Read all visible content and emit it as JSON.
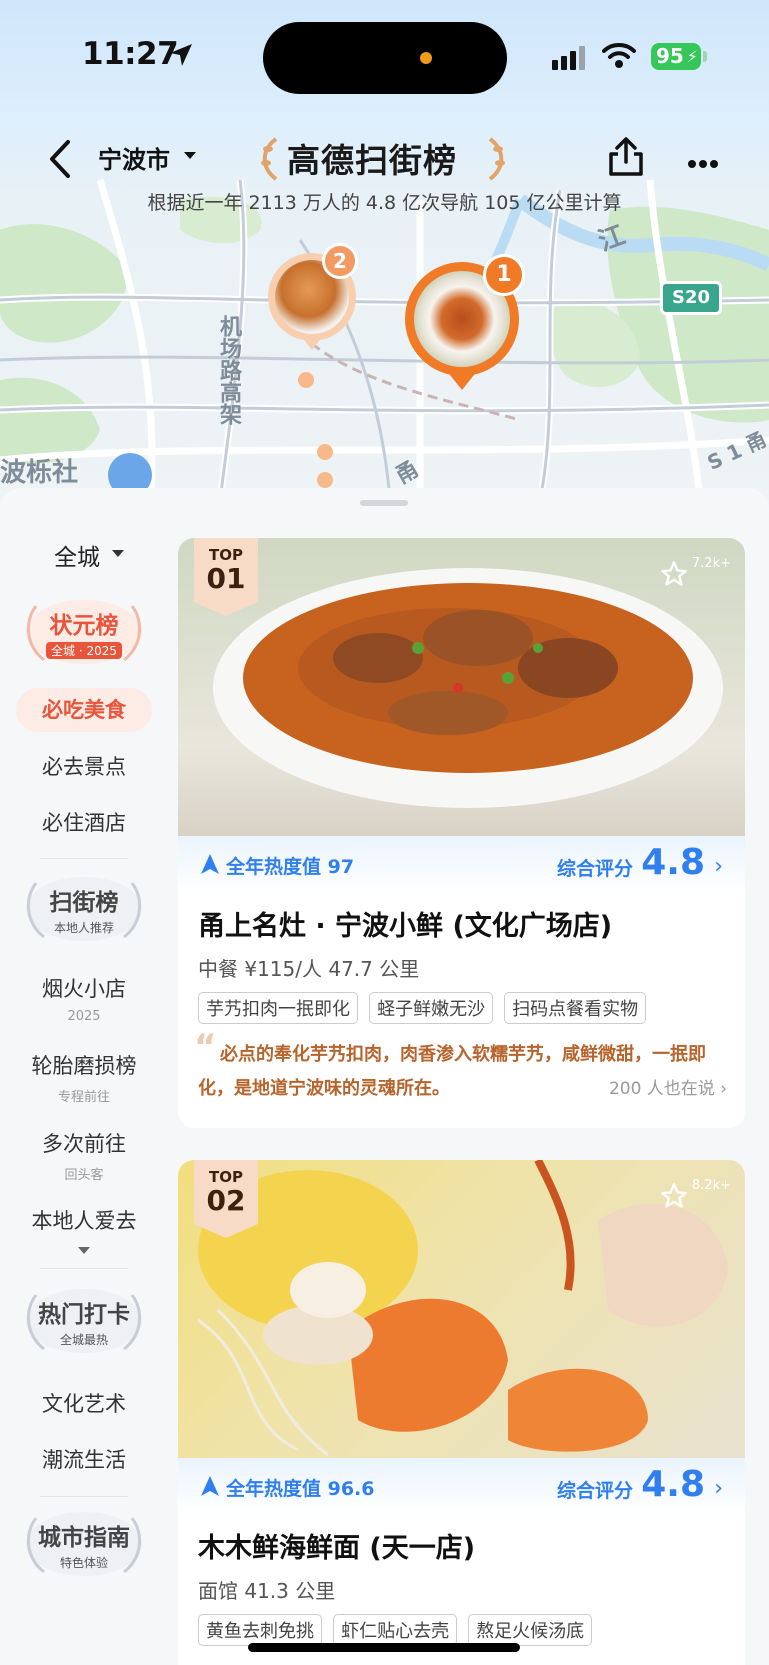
{
  "status_bar": {
    "time": "11:27",
    "battery": "95"
  },
  "header": {
    "city": "宁波市",
    "brand_title": "高德扫街榜",
    "subtitle": "根据近一年 2113 万人的 4.8 亿次导航 105 亿公里计算"
  },
  "map": {
    "labels": {
      "road_airport": "机场路高架",
      "district": "波栎社",
      "river": "江",
      "highway": "S20",
      "road_partial": "甬",
      "ring": "S 1 甬"
    },
    "pins": [
      {
        "rank": "1"
      },
      {
        "rank": "2"
      }
    ]
  },
  "sidebar": {
    "scope": "全城",
    "badges": {
      "zhuangyuan": {
        "title": "状元榜",
        "sub": "全城 · 2025"
      },
      "saojie": {
        "title": "扫街榜",
        "sub": "本地人推荐"
      },
      "remen": {
        "title": "热门打卡",
        "sub": "全城最热"
      },
      "guide": {
        "title": "城市指南",
        "sub": "特色体验"
      }
    },
    "items": {
      "must_eat": "必吃美食",
      "must_go": "必去景点",
      "must_stay": "必住酒店",
      "yanhuo": "烟火小店",
      "yanhuo_sub": "2025",
      "tire": "轮胎磨损榜",
      "tire_sub": "专程前往",
      "multi": "多次前往",
      "multi_sub": "回头客",
      "local": "本地人爱去",
      "culture": "文化艺术",
      "trend": "潮流生活"
    }
  },
  "cards": [
    {
      "top_label": "TOP",
      "top_num": "01",
      "favorites": "7.2k+",
      "heat": "全年热度值 97",
      "score_label": "综合评分",
      "score": "4.8",
      "name": "甬上名灶 · 宁波小鲜 (文化广场店)",
      "meta": "中餐  ¥115/人  47.7 公里",
      "tags": [
        "芋艿扣肉一抿即化",
        "蛏子鲜嫩无沙",
        "扫码点餐看实物"
      ],
      "quote": "必点的奉化芋艿扣肉，肉香渗入软糯芋艿，咸鲜微甜，一抿即化，是地道宁波味的灵魂所在。",
      "also": "200 人也在说"
    },
    {
      "top_label": "TOP",
      "top_num": "02",
      "favorites": "8.2k+",
      "heat": "全年热度值 96.6",
      "score_label": "综合评分",
      "score": "4.8",
      "name": "木木鲜海鲜面 (天一店)",
      "meta": "面馆  41.3 公里",
      "tags": [
        "黄鱼去刺免挑",
        "虾仁贴心去壳",
        "熬足火候汤底"
      ]
    }
  ],
  "colors": {
    "accent_blue": "#2f7ff0",
    "accent_red": "#e8553a",
    "quote_brown": "#b7642c",
    "pin_orange": "#f07a26"
  }
}
